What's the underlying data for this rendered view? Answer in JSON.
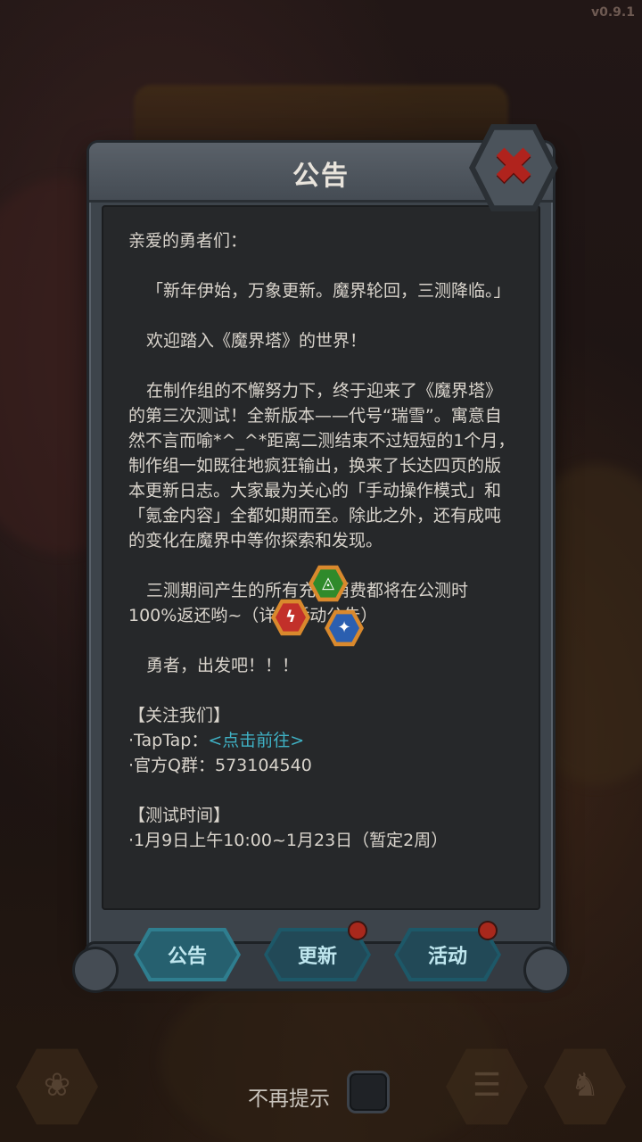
{
  "version": "v0.9.1",
  "dialog": {
    "title": "公告",
    "paragraphs": [
      {
        "text": "亲爱的勇者们：",
        "indent": false
      },
      {
        "gap": true
      },
      {
        "text": "「新年伊始，万象更新。魔界轮回，三测降临。」",
        "indent": true
      },
      {
        "gap": true
      },
      {
        "text": "欢迎踏入《魔界塔》的世界！",
        "indent": true
      },
      {
        "gap": true
      },
      {
        "text": "在制作组的不懈努力下，终于迎来了《魔界塔》的第三次测试！全新版本——代号“瑞雪”。寓意自然不言而喻*^_^*距离二测结束不过短短的1个月，制作组一如既往地疯狂输出，换来了长达四页的版本更新日志。大家最为关心的「手动操作模式」和「氪金内容」全都如期而至。除此之外，还有成吨的变化在魔界中等你探索和发现。",
        "indent": true
      },
      {
        "gap": true
      },
      {
        "text": "三测期间产生的所有充值消费都将在公测时100%返还哟~（详见活动公告）",
        "indent": true
      },
      {
        "gap": true
      },
      {
        "text": "勇者，出发吧！！！",
        "indent": true
      },
      {
        "gap": true
      },
      {
        "text": "【关注我们】",
        "indent": false
      }
    ],
    "taptap_label": "·TapTap：",
    "taptap_link": "<点击前往>",
    "qq_group": "·官方Q群：573104540",
    "test_time_heading": "【测试时间】",
    "test_time": "·1月9日上午10:00~1月23日（暂定2周）"
  },
  "tabs": [
    {
      "label": "公告",
      "active": true,
      "badge": false
    },
    {
      "label": "更新",
      "active": false,
      "badge": true
    },
    {
      "label": "活动",
      "active": false,
      "badge": true
    }
  ],
  "no_remind_label": "不再提示",
  "loading_gems": [
    {
      "color": "#2f8a2b",
      "glyph": "◬"
    },
    {
      "color": "#c2302a",
      "glyph": "ϟ"
    },
    {
      "color": "#2b5fb0",
      "glyph": "✦"
    }
  ]
}
